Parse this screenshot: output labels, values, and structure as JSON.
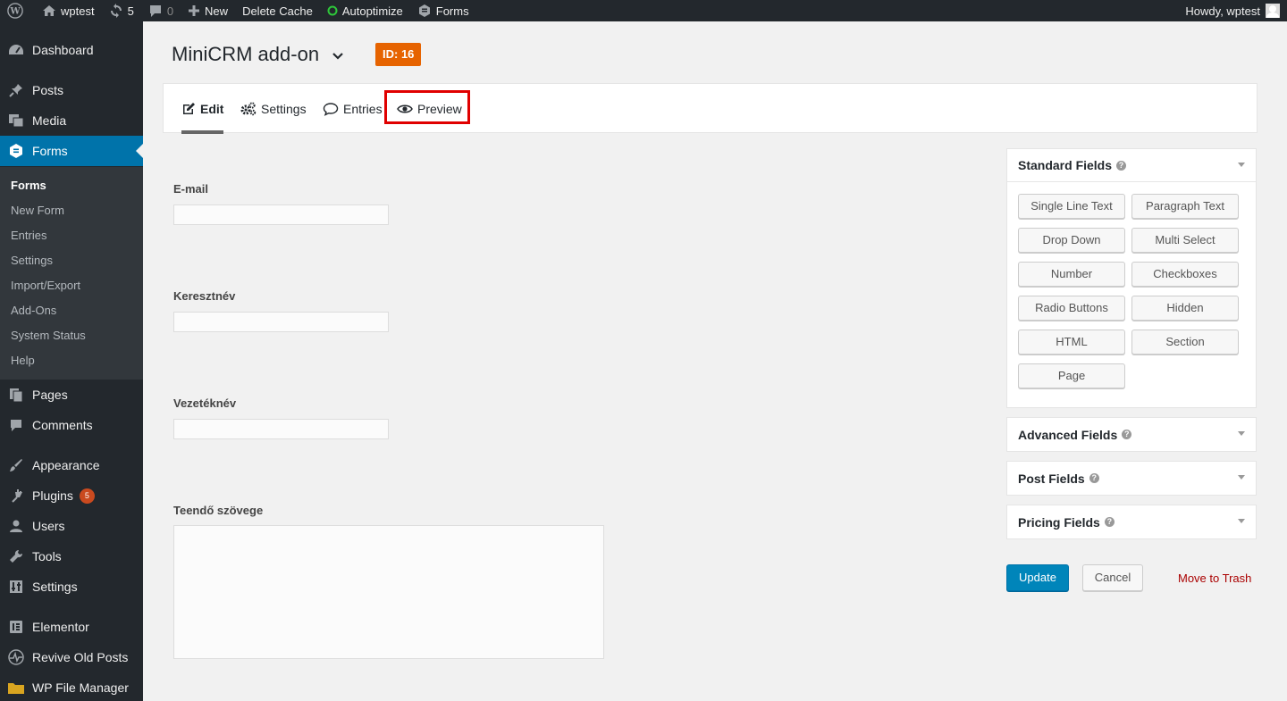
{
  "adminbar": {
    "site": "wptest",
    "updates": "5",
    "comments": "0",
    "new": "New",
    "delete_cache": "Delete Cache",
    "autoptimize": "Autoptimize",
    "forms": "Forms",
    "howdy": "Howdy, wptest"
  },
  "sidebar": {
    "dashboard": "Dashboard",
    "posts": "Posts",
    "media": "Media",
    "forms": "Forms",
    "submenu": [
      "Forms",
      "New Form",
      "Entries",
      "Settings",
      "Import/Export",
      "Add-Ons",
      "System Status",
      "Help"
    ],
    "pages": "Pages",
    "comments": "Comments",
    "appearance": "Appearance",
    "plugins": "Plugins",
    "plugins_badge": "5",
    "users": "Users",
    "tools": "Tools",
    "settings": "Settings",
    "elementor": "Elementor",
    "revive": "Revive Old Posts",
    "file_manager": "WP File Manager"
  },
  "form": {
    "title": "MiniCRM add-on",
    "id_badge": "ID: 16",
    "tabs": [
      "Edit",
      "Settings",
      "Entries",
      "Preview"
    ],
    "fields": [
      "E-mail",
      "Keresztnév",
      "Vezetéknév",
      "Teendő szövege"
    ]
  },
  "panels": {
    "standard": "Standard Fields",
    "advanced": "Advanced Fields",
    "post": "Post Fields",
    "pricing": "Pricing Fields",
    "buttons": [
      "Single Line Text",
      "Paragraph Text",
      "Drop Down",
      "Multi Select",
      "Number",
      "Checkboxes",
      "Radio Buttons",
      "Hidden",
      "HTML",
      "Section",
      "Page"
    ]
  },
  "actions": {
    "update": "Update",
    "cancel": "Cancel",
    "trash": "Move to Trash"
  },
  "colors": {
    "accent": "#0073aa",
    "badge": "#e66300",
    "highlight": "#e00000",
    "trash": "#aa0000"
  }
}
